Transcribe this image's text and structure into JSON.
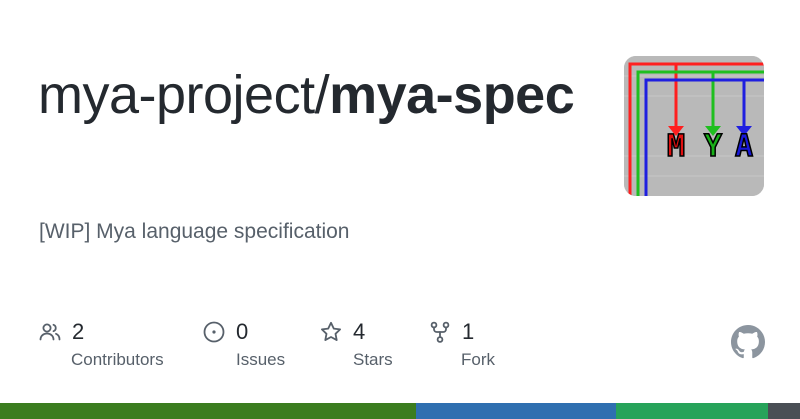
{
  "repo": {
    "owner_prefix": "mya-project/",
    "name": "mya-spec",
    "description": "[WIP] Mya language specification"
  },
  "stats": [
    {
      "icon": "people-icon",
      "value": "2",
      "label": "Contributors"
    },
    {
      "icon": "issue-icon",
      "value": "0",
      "label": "Issues"
    },
    {
      "icon": "star-icon",
      "value": "4",
      "label": "Stars"
    },
    {
      "icon": "fork-icon",
      "value": "1",
      "label": "Fork"
    }
  ],
  "avatar_letters": [
    "M",
    "Y",
    "A"
  ],
  "colors": {
    "title": "#24292f",
    "muted": "#57606a",
    "langbar": [
      "#3b7d1f",
      "#2f6fb0",
      "#27a35a",
      "#4a4f55"
    ]
  },
  "language_bar_fractions": [
    0.52,
    0.25,
    0.19,
    0.04
  ]
}
